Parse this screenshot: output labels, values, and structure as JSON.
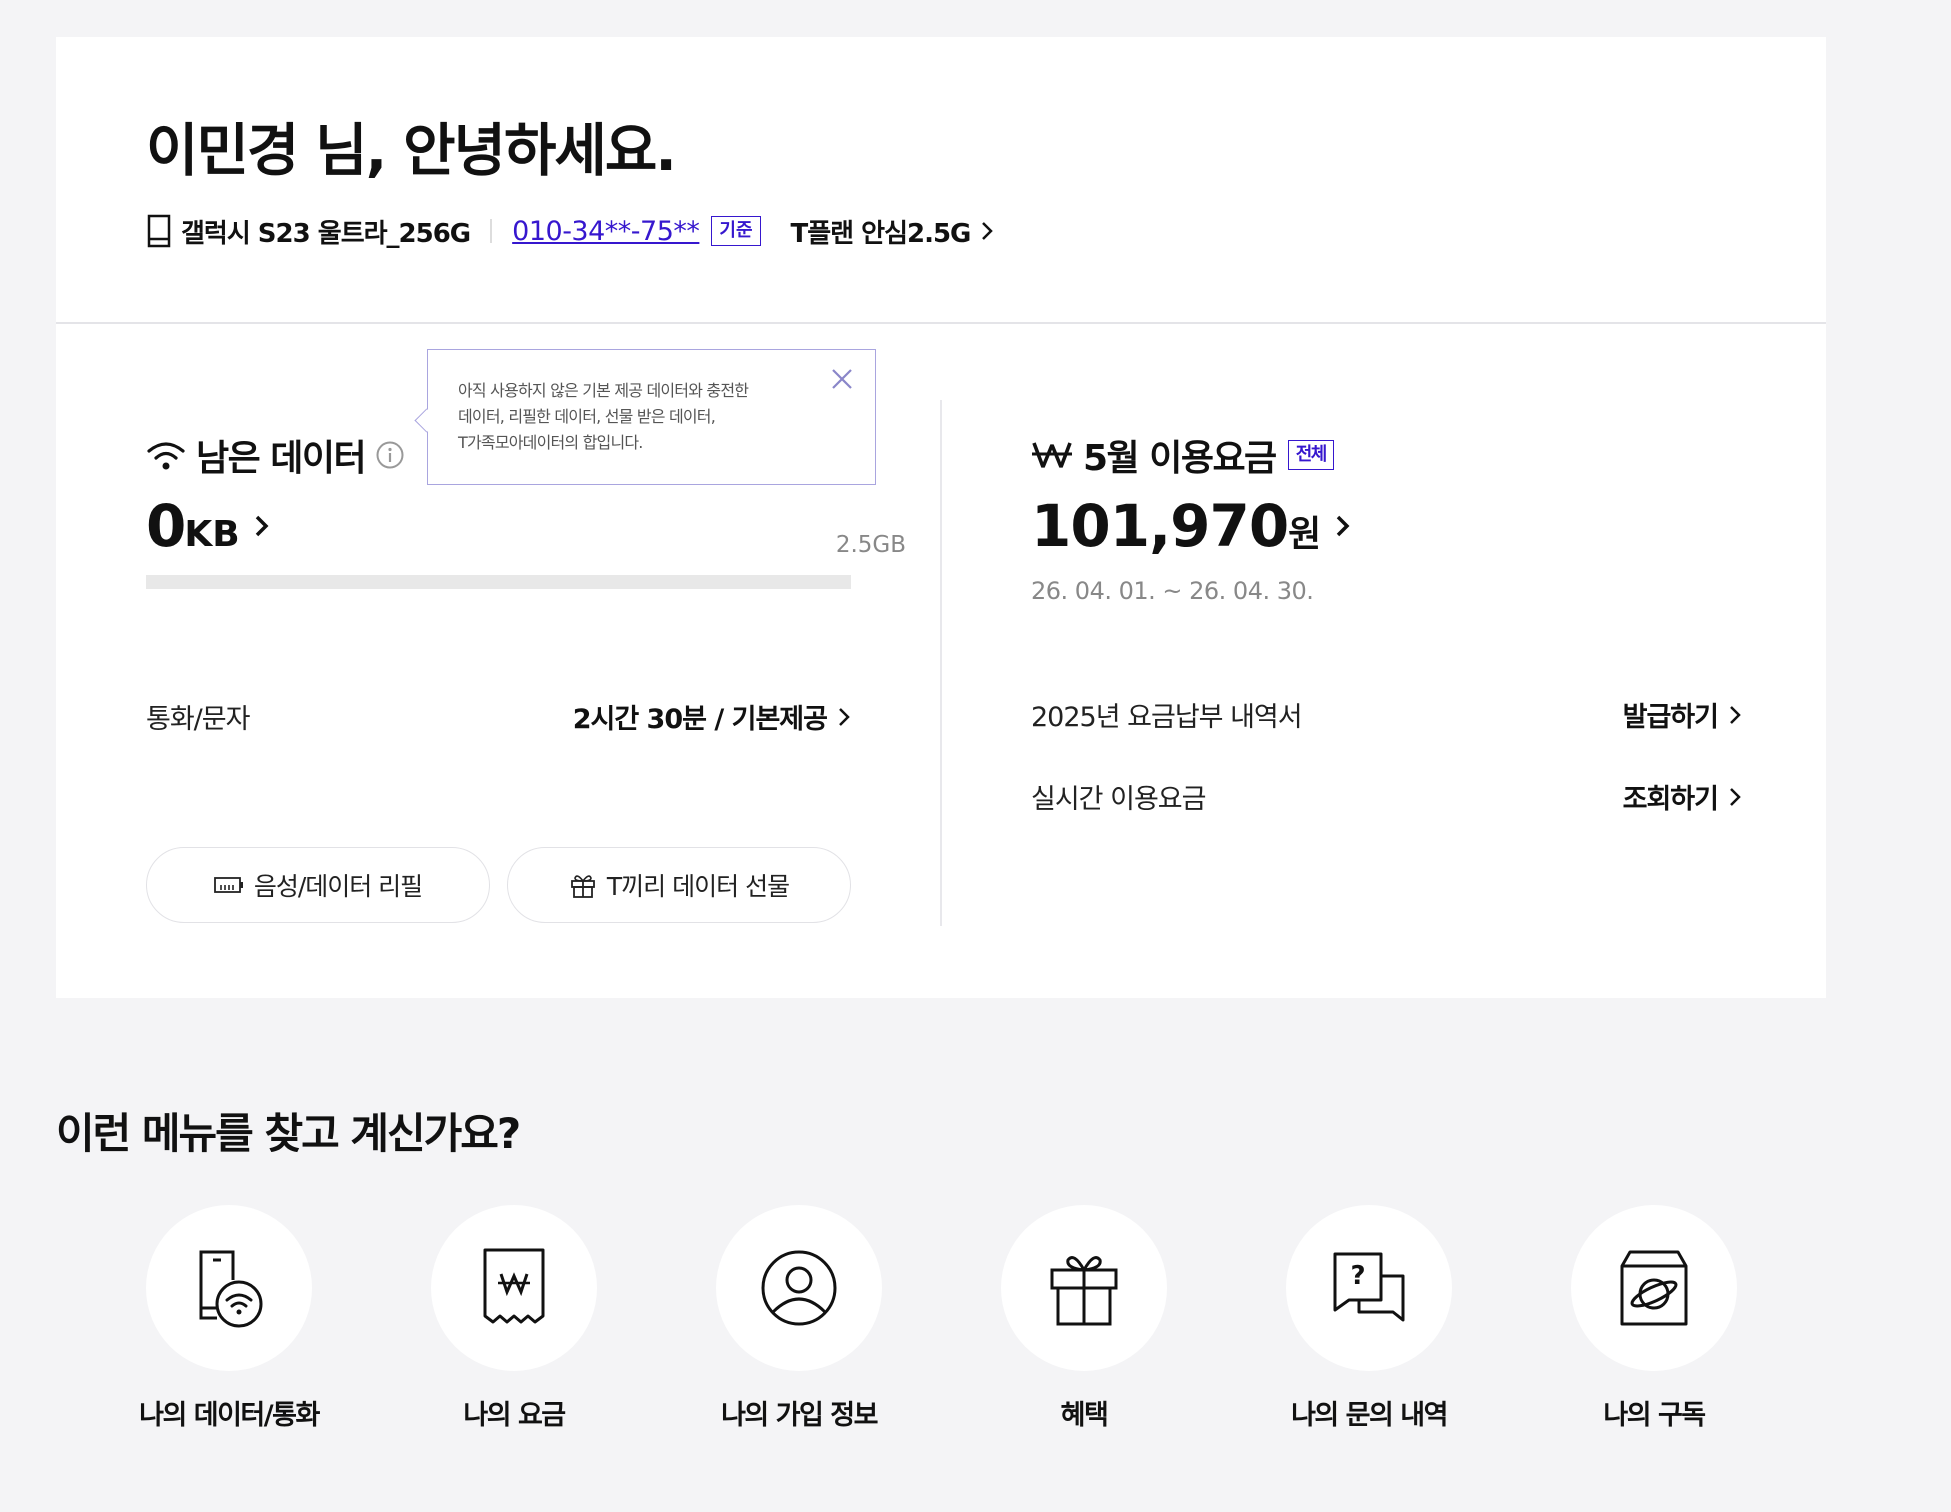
{
  "header": {
    "greeting": "이민경 님, 안녕하세요.",
    "device_name": "갤럭시 S23 울트라_256G",
    "phone_number": "010-34**-75**",
    "phone_badge": "기준",
    "plan_name": "T플랜 안심2.5G"
  },
  "data_section": {
    "title": "남은 데이터",
    "tooltip_lines": [
      "아직 사용하지 않은 기본 제공 데이터와 충전한",
      "데이터, 리필한 데이터, 선물 받은 데이터,",
      "T가족모아데이터의 합입니다."
    ],
    "remaining_value": "0",
    "remaining_unit": "KB",
    "limit_label": "2.5GB",
    "remaining_fraction": 0,
    "call_label": "통화/문자",
    "call_value": "2시간 30분 / 기본제공",
    "refill_button": "음성/데이터 리필",
    "gift_button": "T끼리 데이터 선물"
  },
  "fee_section": {
    "title": "5월 이용요금",
    "badge": "전체",
    "amount": "101,970",
    "unit": "원",
    "period": "26. 04. 01. ~ 26. 04. 30.",
    "rows": [
      {
        "label": "2025년 요금납부 내역서",
        "action": "발급하기"
      },
      {
        "label": "실시간 이용요금",
        "action": "조회하기"
      }
    ]
  },
  "menu": {
    "heading": "이런 메뉴를 찾고 계신가요?",
    "items": [
      {
        "label": "나의 데이터/통화",
        "icon": "phone-wifi-icon"
      },
      {
        "label": "나의 요금",
        "icon": "bill-won-icon"
      },
      {
        "label": "나의 가입 정보",
        "icon": "user-circle-icon"
      },
      {
        "label": "혜택",
        "icon": "gift-icon"
      },
      {
        "label": "나의 문의 내역",
        "icon": "chat-question-icon"
      },
      {
        "label": "나의 구독",
        "icon": "subscription-box-icon"
      }
    ]
  },
  "colors": {
    "accent": "#3617ce",
    "background": "#f4f4f6",
    "card": "#ffffff",
    "muted_text": "#888888"
  }
}
